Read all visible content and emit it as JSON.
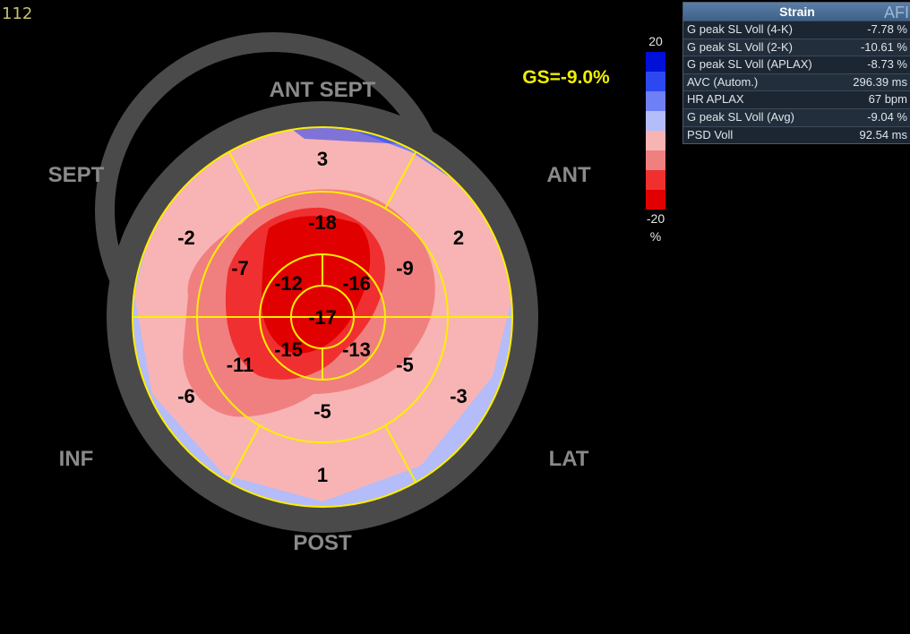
{
  "frame_number": "112",
  "orientation_labels": {
    "ant_sept": "ANT SEPT",
    "sept": "SEPT",
    "ant": "ANT",
    "inf": "INF",
    "lat": "LAT",
    "post": "POST"
  },
  "global_strain": "GS=-9.0%",
  "segments": {
    "basal": [
      "3",
      "2",
      "-3",
      "1",
      "-6",
      "-2"
    ],
    "mid": [
      "-18",
      "-9",
      "-5",
      "-5",
      "-11",
      "-7"
    ],
    "apical": [
      "-16",
      "-13",
      "-15",
      "-12"
    ],
    "apex": "-17"
  },
  "color_scale": {
    "max_label": "20",
    "min_label": "-20",
    "unit": "%",
    "colors": [
      "#0010d8",
      "#2e48f0",
      "#6f7ff8",
      "#b4bcfa",
      "#f8b4b4",
      "#f08080",
      "#f03030",
      "#e00000"
    ]
  },
  "panel": {
    "title": "Strain",
    "badge": "AFI",
    "rows": [
      {
        "label": "G peak SL Voll (4-K)",
        "value": "-7.78 %"
      },
      {
        "label": "G peak SL Voll (2-K)",
        "value": "-10.61 %"
      },
      {
        "label": "G peak SL Voll (APLAX)",
        "value": "-8.73 %"
      },
      {
        "label": "AVC (Autom.)",
        "value": "296.39 ms"
      },
      {
        "label": "HR APLAX",
        "value": "67 bpm"
      },
      {
        "label": "G peak SL Voll (Avg)",
        "value": "-9.04 %"
      },
      {
        "label": "PSD Voll",
        "value": "92.54 ms"
      }
    ]
  }
}
